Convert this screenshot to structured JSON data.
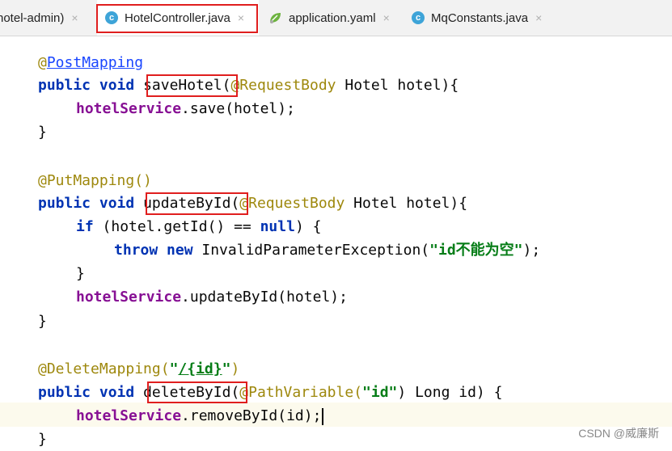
{
  "tabs": [
    {
      "label": "hotel-admin)",
      "close": "×",
      "active": false
    },
    {
      "label": "HotelController.java",
      "close": "×",
      "active": true,
      "icon": "java-class-icon",
      "icon_glyph": "c"
    },
    {
      "label": "application.yaml",
      "close": "×",
      "active": false,
      "icon": "spring-leaf-icon"
    },
    {
      "label": "MqConstants.java",
      "close": "×",
      "active": false,
      "icon": "java-class-icon",
      "icon_glyph": "c"
    }
  ],
  "code": {
    "l1": {
      "at": "@",
      "ann": "PostMapping"
    },
    "l2": {
      "kw1": "public",
      "kw2": "void",
      "method": "saveHotel",
      "open": "(",
      "ann": "@RequestBody",
      "rest": " Hotel hotel){"
    },
    "l3": {
      "field": "hotelService",
      "rest": ".save(hotel);"
    },
    "l4": {
      "text": "}"
    },
    "l5": {
      "ann": "@PutMapping",
      "rest": "()"
    },
    "l6": {
      "kw1": "public",
      "kw2": "void",
      "method": "updateById",
      "open": "(",
      "ann": "@RequestBody",
      "rest": " Hotel hotel){"
    },
    "l7": {
      "kw1": "if",
      "mid": " (hotel.getId() == ",
      "kw2": "null",
      "rest": ") {"
    },
    "l8": {
      "kw1": "throw",
      "kw2": "new",
      "mid": " InvalidParameterException(",
      "str": "\"id不能为空\"",
      "rest": ");"
    },
    "l9": {
      "text": "}"
    },
    "l10": {
      "field": "hotelService",
      "rest": ".updateById(hotel);"
    },
    "l11": {
      "text": "}"
    },
    "l12": {
      "ann": "@DeleteMapping",
      "open": "(",
      "q1": "\"",
      "path": "/{id}",
      "q2": "\"",
      "rest": ")"
    },
    "l13": {
      "kw1": "public",
      "kw2": "void",
      "method": "deleteById",
      "open": "(",
      "ann": "@PathVariable",
      "open2": "(",
      "str": "\"id\"",
      "rest": ") Long id) {"
    },
    "l14": {
      "field": "hotelService",
      "rest": ".removeById(id);"
    },
    "l15": {
      "text": "}"
    }
  },
  "colors": {
    "keyword": "#0033b3",
    "annotation": "#9e880d",
    "field": "#871094",
    "string": "#067d17",
    "highlight_box": "#e01e1e"
  },
  "watermark": "CSDN @威廉斯"
}
